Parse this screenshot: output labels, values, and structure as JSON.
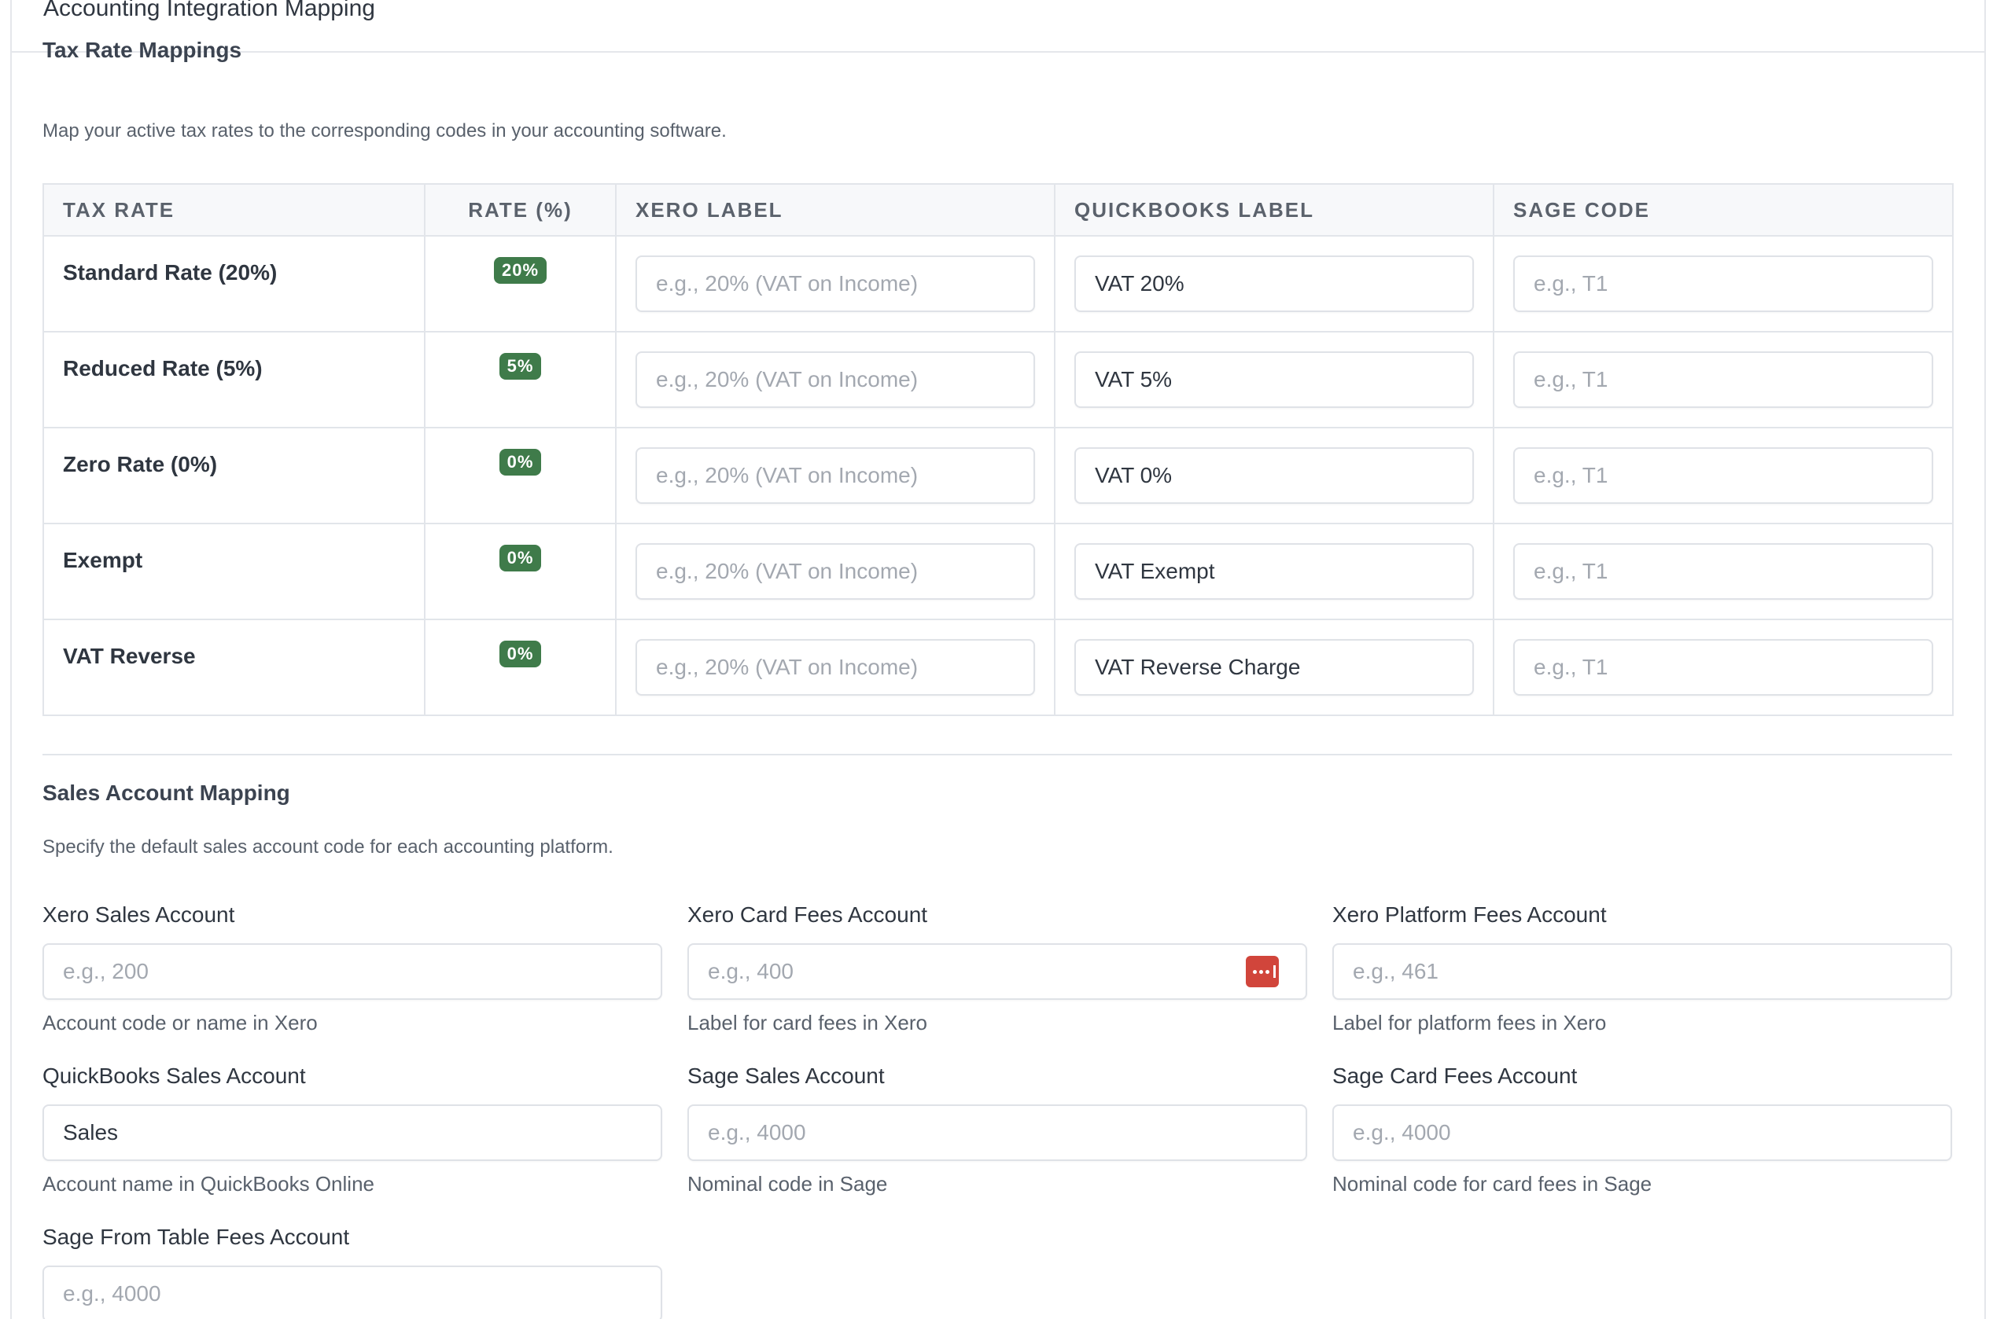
{
  "card": {
    "title": "Accounting Integration Mapping"
  },
  "tax_section": {
    "title": "Tax Rate Mappings",
    "description": "Map your active tax rates to the corresponding codes in your accounting software.",
    "columns": [
      "TAX RATE",
      "RATE (%)",
      "XERO LABEL",
      "QUICKBOOKS LABEL",
      "SAGE CODE"
    ],
    "placeholders": {
      "xero": "e.g., 20% (VAT on Income)",
      "sage": "e.g., T1"
    },
    "rows": [
      {
        "name": "Standard Rate (20%)",
        "rate": "20%",
        "xero": "",
        "quickbooks": "VAT 20%",
        "sage": ""
      },
      {
        "name": "Reduced Rate (5%)",
        "rate": "5%",
        "xero": "",
        "quickbooks": "VAT 5%",
        "sage": ""
      },
      {
        "name": "Zero Rate (0%)",
        "rate": "0%",
        "xero": "",
        "quickbooks": "VAT 0%",
        "sage": ""
      },
      {
        "name": "Exempt",
        "rate": "0%",
        "xero": "",
        "quickbooks": "VAT Exempt",
        "sage": ""
      },
      {
        "name": "VAT Reverse",
        "rate": "0%",
        "xero": "",
        "quickbooks": "VAT Reverse Charge",
        "sage": ""
      }
    ],
    "badge_color": "#3f7b4a"
  },
  "sales_section": {
    "title": "Sales Account Mapping",
    "description": "Specify the default sales account code for each accounting platform.",
    "fields": [
      {
        "label": "Xero Sales Account",
        "value": "",
        "placeholder": "e.g., 200",
        "help": "Account code or name in Xero"
      },
      {
        "label": "Xero Card Fees Account",
        "value": "",
        "placeholder": "e.g., 400",
        "help": "Label for card fees in Xero",
        "icon": "password-manager-icon"
      },
      {
        "label": "Xero Platform Fees Account",
        "value": "",
        "placeholder": "e.g., 461",
        "help": "Label for platform fees in Xero"
      },
      {
        "label": "QuickBooks Sales Account",
        "value": "Sales",
        "placeholder": "",
        "help": "Account name in QuickBooks Online"
      },
      {
        "label": "Sage Sales Account",
        "value": "",
        "placeholder": "e.g., 4000",
        "help": "Nominal code in Sage"
      },
      {
        "label": "Sage Card Fees Account",
        "value": "",
        "placeholder": "e.g., 4000",
        "help": "Nominal code for card fees in Sage"
      },
      {
        "label": "Sage From Table Fees Account",
        "value": "",
        "placeholder": "e.g., 4000",
        "help": ""
      }
    ],
    "icon_color": "#d1453b"
  }
}
